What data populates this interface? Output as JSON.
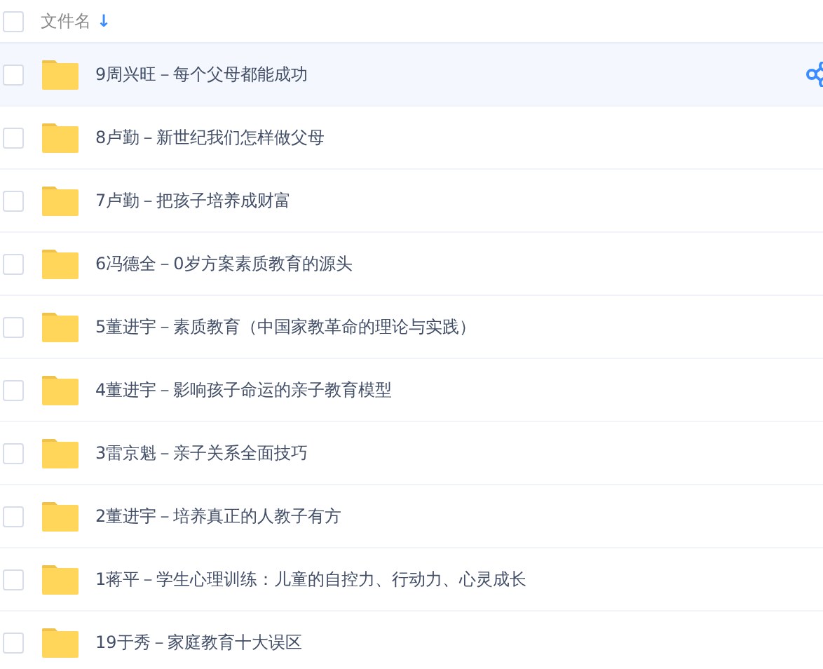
{
  "header": {
    "checked": false,
    "column_label": "文件名",
    "sort_arrow": "↓"
  },
  "rows": [
    {
      "name": "9周兴旺－每个父母都能成功",
      "checked": false,
      "highlighted": true
    },
    {
      "name": "8卢勤－新世纪我们怎样做父母",
      "checked": false,
      "highlighted": false
    },
    {
      "name": "7卢勤－把孩子培养成财富",
      "checked": false,
      "highlighted": false
    },
    {
      "name": "6冯德全－0岁方案素质教育的源头",
      "checked": false,
      "highlighted": false
    },
    {
      "name": "5董进宇－素质教育（中国家教革命的理论与实践）",
      "checked": false,
      "highlighted": false
    },
    {
      "name": "4董进宇－影响孩子命运的亲子教育模型",
      "checked": false,
      "highlighted": false
    },
    {
      "name": "3雷京魁－亲子关系全面技巧",
      "checked": false,
      "highlighted": false
    },
    {
      "name": "2董进宇－培养真正的人教子有方",
      "checked": false,
      "highlighted": false
    },
    {
      "name": "1蒋平－学生心理训练：儿童的自控力、行动力、心灵成长",
      "checked": false,
      "highlighted": false
    },
    {
      "name": "19于秀－家庭教育十大误区",
      "checked": false,
      "highlighted": false
    }
  ]
}
